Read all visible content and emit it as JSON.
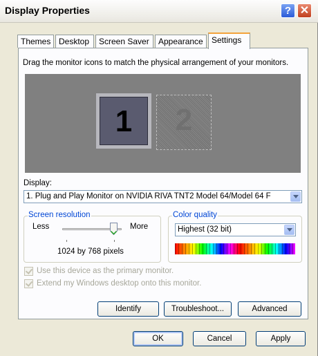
{
  "window": {
    "title": "Display Properties"
  },
  "titlebar": {
    "help_icon": "?",
    "close_icon": "✕"
  },
  "tabs": [
    {
      "label": "Themes"
    },
    {
      "label": "Desktop"
    },
    {
      "label": "Screen Saver"
    },
    {
      "label": "Appearance"
    },
    {
      "label": "Settings",
      "active": true
    }
  ],
  "settings": {
    "hint": "Drag the monitor icons to match the physical arrangement of your monitors.",
    "monitors": [
      {
        "number": "1",
        "selected": true
      },
      {
        "number": "2",
        "selected": false
      }
    ],
    "display_label": "Display:",
    "display_value": "1. Plug and Play Monitor on NVIDIA RIVA TNT2 Model 64/Model 64 F",
    "resolution": {
      "group_title": "Screen resolution",
      "less_label": "Less",
      "more_label": "More",
      "value_text": "1024 by 768 pixels",
      "slider_level": 0.8
    },
    "color_quality": {
      "group_title": "Color quality",
      "selected": "Highest (32 bit)"
    },
    "primary_monitor": {
      "label": "Use this device as the primary monitor.",
      "checked": true,
      "disabled": true
    },
    "extend_desktop": {
      "label": "Extend my Windows desktop onto this monitor.",
      "checked": true,
      "disabled": true
    },
    "buttons": {
      "identify": "Identify",
      "troubleshoot": "Troubleshoot...",
      "advanced": "Advanced"
    }
  },
  "footer": {
    "ok": "OK",
    "cancel": "Cancel",
    "apply": "Apply"
  },
  "colors": {
    "tab_highlight": "#f3a33b",
    "group_title": "#0046d5",
    "preview_bg": "#808080"
  }
}
